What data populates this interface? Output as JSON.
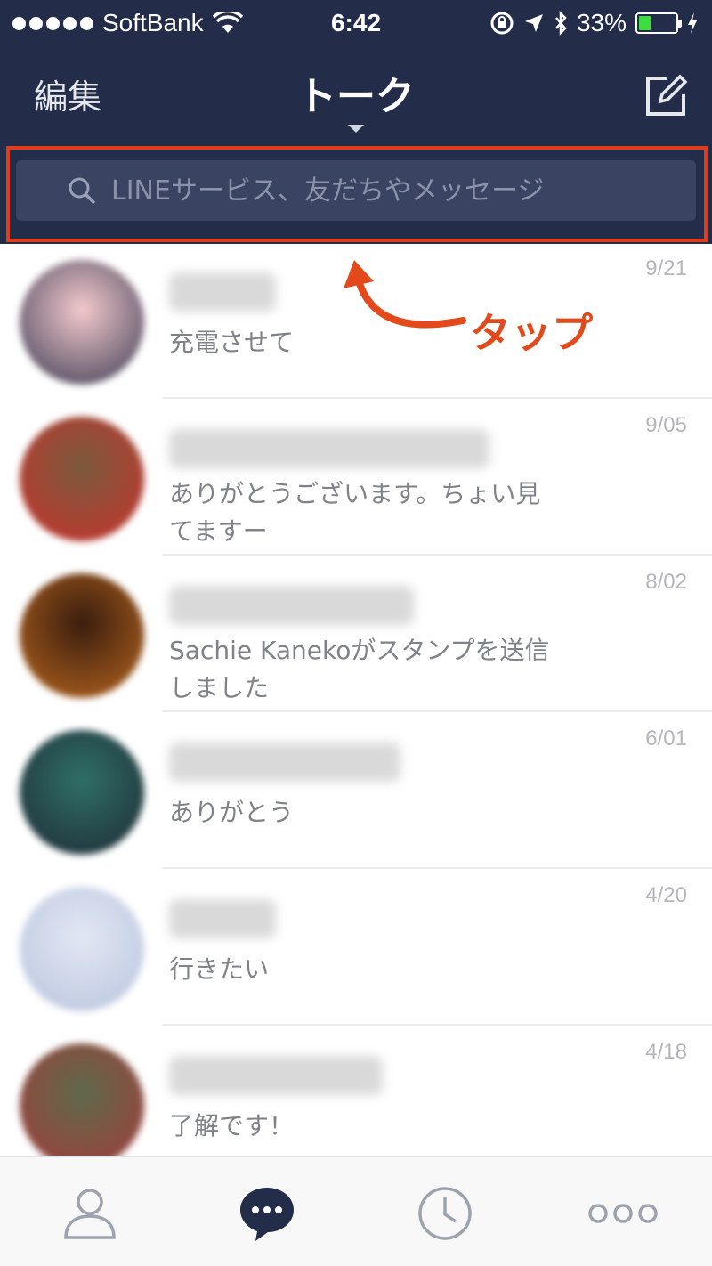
{
  "status_bar": {
    "carrier": "SoftBank",
    "time": "6:42",
    "battery_percent": "33%",
    "battery_level": 0.33,
    "battery_color": "#3fdc3f"
  },
  "header": {
    "edit_label": "編集",
    "title": "トーク",
    "compose_icon": "compose-icon",
    "background_color": "#232c48"
  },
  "search": {
    "placeholder": "LINEサービス、友だちやメッセージ",
    "icon": "search-icon"
  },
  "annotation": {
    "label": "タップ",
    "color": "#e24a1c"
  },
  "chats": [
    {
      "date": "9/21",
      "message": "充電させて",
      "avatar_colors": [
        "#f3c9cd",
        "#3b3a52"
      ]
    },
    {
      "date": "9/05",
      "message": "ありがとうございます。ちょい見てますー",
      "avatar_colors": [
        "#7a5a3c",
        "#c8322d"
      ]
    },
    {
      "date": "8/02",
      "message": "Sachie Kanekoがスタンプを送信しました",
      "avatar_colors": [
        "#3a1d0e",
        "#b8661f"
      ]
    },
    {
      "date": "6/01",
      "message": "ありがとう",
      "avatar_colors": [
        "#2f6f66",
        "#1f2a36"
      ]
    },
    {
      "date": "4/20",
      "message": "行きたい",
      "avatar_colors": [
        "#e2e7f3",
        "#b8c4de"
      ]
    },
    {
      "date": "4/18",
      "message": "了解です！",
      "avatar_colors": [
        "#5e6a4a",
        "#a43b3b"
      ]
    }
  ],
  "tab_bar": {
    "tabs": [
      {
        "icon": "friends-icon",
        "active": false
      },
      {
        "icon": "chats-icon",
        "active": true
      },
      {
        "icon": "timeline-icon",
        "active": false
      },
      {
        "icon": "more-icon",
        "active": false
      }
    ],
    "active_color": "#232c48",
    "inactive_color": "#9da3ae"
  }
}
